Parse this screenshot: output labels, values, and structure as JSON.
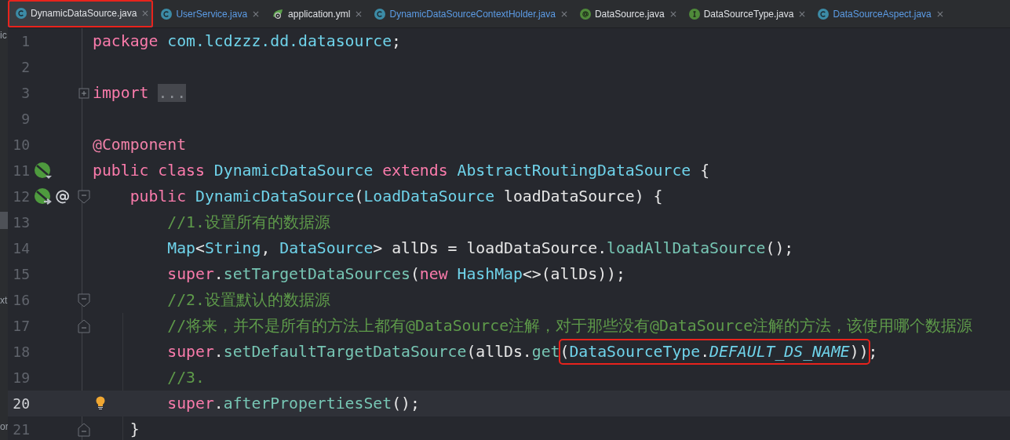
{
  "tabs": [
    {
      "label": "DynamicDataSource.java",
      "kind": "class",
      "selected": true,
      "modified": false,
      "boxed": true
    },
    {
      "label": "UserService.java",
      "kind": "class",
      "selected": false,
      "modified": true,
      "boxed": false
    },
    {
      "label": "application.yml",
      "kind": "yaml",
      "selected": false,
      "modified": false,
      "boxed": false
    },
    {
      "label": "DynamicDataSourceContextHolder.java",
      "kind": "class",
      "selected": false,
      "modified": true,
      "boxed": false
    },
    {
      "label": "DataSource.java",
      "kind": "annotation",
      "selected": false,
      "modified": false,
      "boxed": false
    },
    {
      "label": "DataSourceType.java",
      "kind": "interface",
      "selected": false,
      "modified": false,
      "boxed": false
    },
    {
      "label": "DataSourceAspect.java",
      "kind": "class",
      "selected": false,
      "modified": true,
      "boxed": false
    }
  ],
  "side_panel_fragments": [
    "ic",
    "xt",
    "or"
  ],
  "lines": [
    {
      "number": "1",
      "current": false,
      "tokens": [
        {
          "t": "package ",
          "kind": "keyword"
        },
        {
          "t": "com.lcdzzz.dd.datasource",
          "kind": "type"
        },
        {
          "t": ";",
          "kind": "plain"
        }
      ]
    },
    {
      "number": "2",
      "current": false
    },
    {
      "number": "3",
      "current": false,
      "fold": {
        "kind": "expand"
      },
      "tokens": [
        {
          "t": "import ",
          "kind": "keyword"
        },
        {
          "t": "...",
          "kind": "folded"
        }
      ]
    },
    {
      "number": "9",
      "current": false
    },
    {
      "number": "10",
      "current": false,
      "tokens": [
        {
          "t": "@Component",
          "kind": "annotation"
        }
      ]
    },
    {
      "number": "11",
      "current": false,
      "gutter": [
        {
          "kind": "implemented"
        }
      ],
      "tokens": [
        {
          "t": "public class ",
          "kind": "keyword"
        },
        {
          "t": "DynamicDataSource ",
          "kind": "type"
        },
        {
          "t": "extends ",
          "kind": "keyword"
        },
        {
          "t": "AbstractRoutingDataSource ",
          "kind": "type"
        },
        {
          "t": "{",
          "kind": "plain"
        }
      ]
    },
    {
      "number": "12",
      "current": false,
      "gutter": [
        {
          "kind": "overrides"
        },
        {
          "kind": "autowired"
        }
      ],
      "fold": {
        "kind": "start"
      },
      "tokens": [
        {
          "t": "    public ",
          "kind": "keyword"
        },
        {
          "t": "DynamicDataSource",
          "kind": "type"
        },
        {
          "t": "(",
          "kind": "plain"
        },
        {
          "t": "LoadDataSource ",
          "kind": "type"
        },
        {
          "t": "loadDataSource) {",
          "kind": "plain"
        }
      ]
    },
    {
      "number": "13",
      "current": false,
      "tokens": [
        {
          "t": "        //1.设置所有的数据源",
          "kind": "comment"
        }
      ]
    },
    {
      "number": "14",
      "current": false,
      "tokens": [
        {
          "t": "        Map",
          "kind": "type"
        },
        {
          "t": "<",
          "kind": "plain"
        },
        {
          "t": "String",
          "kind": "type"
        },
        {
          "t": ", ",
          "kind": "plain"
        },
        {
          "t": "DataSource",
          "kind": "type"
        },
        {
          "t": "> allDs = loadDataSource.",
          "kind": "plain"
        },
        {
          "t": "loadAllDataSource",
          "kind": "method"
        },
        {
          "t": "();",
          "kind": "plain"
        }
      ]
    },
    {
      "number": "15",
      "current": false,
      "tokens": [
        {
          "t": "        super",
          "kind": "keyword"
        },
        {
          "t": ".",
          "kind": "plain"
        },
        {
          "t": "setTargetDataSources",
          "kind": "method"
        },
        {
          "t": "(",
          "kind": "plain"
        },
        {
          "t": "new ",
          "kind": "keyword"
        },
        {
          "t": "HashMap",
          "kind": "type"
        },
        {
          "t": "<>(allDs));",
          "kind": "plain"
        }
      ]
    },
    {
      "number": "16",
      "current": false,
      "fold": {
        "kind": "start"
      },
      "tokens": [
        {
          "t": "        //2.设置默认的数据源",
          "kind": "comment"
        }
      ]
    },
    {
      "number": "17",
      "current": false,
      "fold": {
        "kind": "end"
      },
      "tokens": [
        {
          "t": "        //将来，并不是所有的方法上都有@DataSource注解，对于那些没有@DataSource注解的方法，该使用哪个数据源",
          "kind": "comment"
        }
      ]
    },
    {
      "number": "18",
      "current": false,
      "tokens": [
        {
          "t": "        super",
          "kind": "keyword"
        },
        {
          "t": ".",
          "kind": "plain"
        },
        {
          "t": "setDefaultTargetDataSource",
          "kind": "method"
        },
        {
          "t": "(allDs.",
          "kind": "plain"
        },
        {
          "t": "get",
          "kind": "method"
        },
        {
          "kind": "box",
          "tokens": [
            {
              "t": "(",
              "kind": "plain"
            },
            {
              "t": "DataSourceType",
              "kind": "type"
            },
            {
              "t": ".",
              "kind": "plain"
            },
            {
              "t": "DEFAULT_DS_NAME",
              "kind": "static"
            },
            {
              "t": "))",
              "kind": "plain"
            }
          ]
        },
        {
          "t": ";",
          "kind": "plain"
        }
      ]
    },
    {
      "number": "19",
      "current": false,
      "tokens": [
        {
          "t": "        //3.",
          "kind": "comment"
        }
      ]
    },
    {
      "number": "20",
      "current": true,
      "gutter": [
        {
          "kind": "bulb"
        }
      ],
      "tokens": [
        {
          "t": "        super",
          "kind": "keyword"
        },
        {
          "t": ".",
          "kind": "plain"
        },
        {
          "t": "afterPropertiesSet",
          "kind": "method"
        },
        {
          "t": "();",
          "kind": "plain"
        }
      ]
    },
    {
      "number": "21",
      "current": false,
      "fold": {
        "kind": "end"
      },
      "tokens": [
        {
          "t": "    }",
          "kind": "plain"
        }
      ]
    }
  ]
}
